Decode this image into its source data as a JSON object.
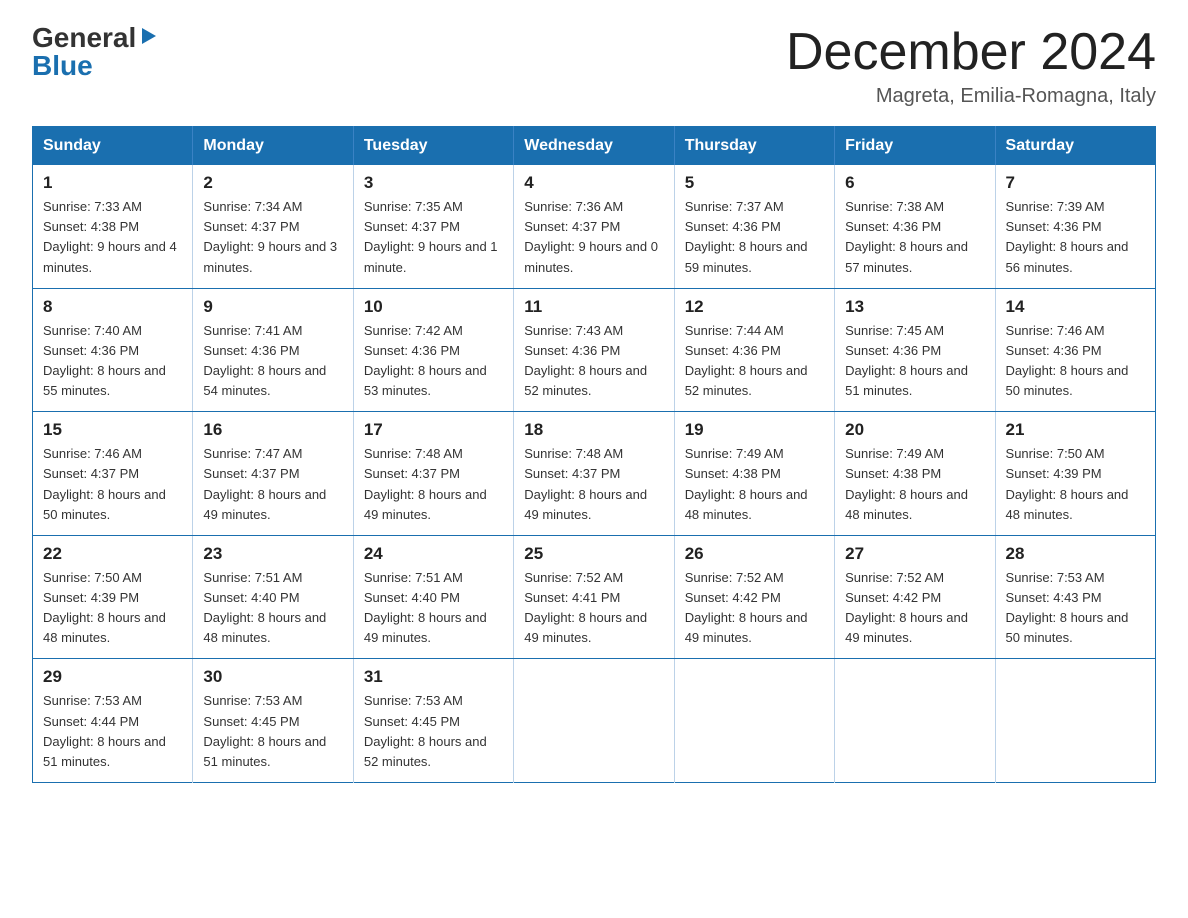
{
  "header": {
    "logo": {
      "general": "General",
      "blue": "Blue",
      "arrow": "▶"
    },
    "title": "December 2024",
    "subtitle": "Magreta, Emilia-Romagna, Italy"
  },
  "days_of_week": [
    "Sunday",
    "Monday",
    "Tuesday",
    "Wednesday",
    "Thursday",
    "Friday",
    "Saturday"
  ],
  "weeks": [
    [
      {
        "day": "1",
        "sunrise": "7:33 AM",
        "sunset": "4:38 PM",
        "daylight": "9 hours and 4 minutes."
      },
      {
        "day": "2",
        "sunrise": "7:34 AM",
        "sunset": "4:37 PM",
        "daylight": "9 hours and 3 minutes."
      },
      {
        "day": "3",
        "sunrise": "7:35 AM",
        "sunset": "4:37 PM",
        "daylight": "9 hours and 1 minute."
      },
      {
        "day": "4",
        "sunrise": "7:36 AM",
        "sunset": "4:37 PM",
        "daylight": "9 hours and 0 minutes."
      },
      {
        "day": "5",
        "sunrise": "7:37 AM",
        "sunset": "4:36 PM",
        "daylight": "8 hours and 59 minutes."
      },
      {
        "day": "6",
        "sunrise": "7:38 AM",
        "sunset": "4:36 PM",
        "daylight": "8 hours and 57 minutes."
      },
      {
        "day": "7",
        "sunrise": "7:39 AM",
        "sunset": "4:36 PM",
        "daylight": "8 hours and 56 minutes."
      }
    ],
    [
      {
        "day": "8",
        "sunrise": "7:40 AM",
        "sunset": "4:36 PM",
        "daylight": "8 hours and 55 minutes."
      },
      {
        "day": "9",
        "sunrise": "7:41 AM",
        "sunset": "4:36 PM",
        "daylight": "8 hours and 54 minutes."
      },
      {
        "day": "10",
        "sunrise": "7:42 AM",
        "sunset": "4:36 PM",
        "daylight": "8 hours and 53 minutes."
      },
      {
        "day": "11",
        "sunrise": "7:43 AM",
        "sunset": "4:36 PM",
        "daylight": "8 hours and 52 minutes."
      },
      {
        "day": "12",
        "sunrise": "7:44 AM",
        "sunset": "4:36 PM",
        "daylight": "8 hours and 52 minutes."
      },
      {
        "day": "13",
        "sunrise": "7:45 AM",
        "sunset": "4:36 PM",
        "daylight": "8 hours and 51 minutes."
      },
      {
        "day": "14",
        "sunrise": "7:46 AM",
        "sunset": "4:36 PM",
        "daylight": "8 hours and 50 minutes."
      }
    ],
    [
      {
        "day": "15",
        "sunrise": "7:46 AM",
        "sunset": "4:37 PM",
        "daylight": "8 hours and 50 minutes."
      },
      {
        "day": "16",
        "sunrise": "7:47 AM",
        "sunset": "4:37 PM",
        "daylight": "8 hours and 49 minutes."
      },
      {
        "day": "17",
        "sunrise": "7:48 AM",
        "sunset": "4:37 PM",
        "daylight": "8 hours and 49 minutes."
      },
      {
        "day": "18",
        "sunrise": "7:48 AM",
        "sunset": "4:37 PM",
        "daylight": "8 hours and 49 minutes."
      },
      {
        "day": "19",
        "sunrise": "7:49 AM",
        "sunset": "4:38 PM",
        "daylight": "8 hours and 48 minutes."
      },
      {
        "day": "20",
        "sunrise": "7:49 AM",
        "sunset": "4:38 PM",
        "daylight": "8 hours and 48 minutes."
      },
      {
        "day": "21",
        "sunrise": "7:50 AM",
        "sunset": "4:39 PM",
        "daylight": "8 hours and 48 minutes."
      }
    ],
    [
      {
        "day": "22",
        "sunrise": "7:50 AM",
        "sunset": "4:39 PM",
        "daylight": "8 hours and 48 minutes."
      },
      {
        "day": "23",
        "sunrise": "7:51 AM",
        "sunset": "4:40 PM",
        "daylight": "8 hours and 48 minutes."
      },
      {
        "day": "24",
        "sunrise": "7:51 AM",
        "sunset": "4:40 PM",
        "daylight": "8 hours and 49 minutes."
      },
      {
        "day": "25",
        "sunrise": "7:52 AM",
        "sunset": "4:41 PM",
        "daylight": "8 hours and 49 minutes."
      },
      {
        "day": "26",
        "sunrise": "7:52 AM",
        "sunset": "4:42 PM",
        "daylight": "8 hours and 49 minutes."
      },
      {
        "day": "27",
        "sunrise": "7:52 AM",
        "sunset": "4:42 PM",
        "daylight": "8 hours and 49 minutes."
      },
      {
        "day": "28",
        "sunrise": "7:53 AM",
        "sunset": "4:43 PM",
        "daylight": "8 hours and 50 minutes."
      }
    ],
    [
      {
        "day": "29",
        "sunrise": "7:53 AM",
        "sunset": "4:44 PM",
        "daylight": "8 hours and 51 minutes."
      },
      {
        "day": "30",
        "sunrise": "7:53 AM",
        "sunset": "4:45 PM",
        "daylight": "8 hours and 51 minutes."
      },
      {
        "day": "31",
        "sunrise": "7:53 AM",
        "sunset": "4:45 PM",
        "daylight": "8 hours and 52 minutes."
      },
      null,
      null,
      null,
      null
    ]
  ],
  "labels": {
    "sunrise": "Sunrise:",
    "sunset": "Sunset:",
    "daylight": "Daylight:"
  }
}
